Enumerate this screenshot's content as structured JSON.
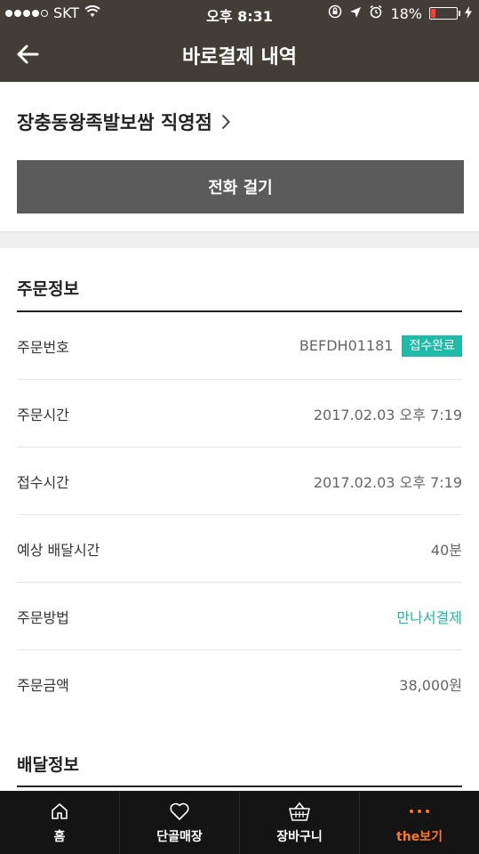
{
  "status_bar": {
    "carrier": "SKT",
    "time": "오후 8:31",
    "battery": "18%",
    "battery_level": 0.18,
    "battery_color": "#ff3b30"
  },
  "header": {
    "title": "바로결제 내역",
    "back_icon": "arrow-left-icon"
  },
  "store": {
    "name": "장충동왕족발보쌈 직영점",
    "call_label": "전화 걸기"
  },
  "order_info": {
    "title": "주문정보",
    "rows": [
      {
        "label": "주문번호",
        "value": "BEFDH01181",
        "badge": "접수완료"
      },
      {
        "label": "주문시간",
        "value": "2017.02.03 오후 7:19"
      },
      {
        "label": "접수시간",
        "value": "2017.02.03 오후 7:19"
      },
      {
        "label": "예상 배달시간",
        "value": "40분"
      },
      {
        "label": "주문방법",
        "value": "만나서결제"
      },
      {
        "label": "주문금액",
        "value": "38,000원"
      }
    ]
  },
  "delivery_info": {
    "title": "배달정보"
  },
  "tab_bar": {
    "tabs": [
      {
        "label": "홈",
        "icon": "home-icon"
      },
      {
        "label": "단골매장",
        "icon": "heart-icon"
      },
      {
        "label": "장바구니",
        "icon": "basket-icon"
      },
      {
        "label": "the보기",
        "icon": "more-dots-icon",
        "active": true
      }
    ]
  },
  "colors": {
    "header_bg": "#433d37",
    "accent_teal": "#1fbba9",
    "active_tab": "#ff7a21",
    "call_button_bg": "#5b5b5b"
  }
}
